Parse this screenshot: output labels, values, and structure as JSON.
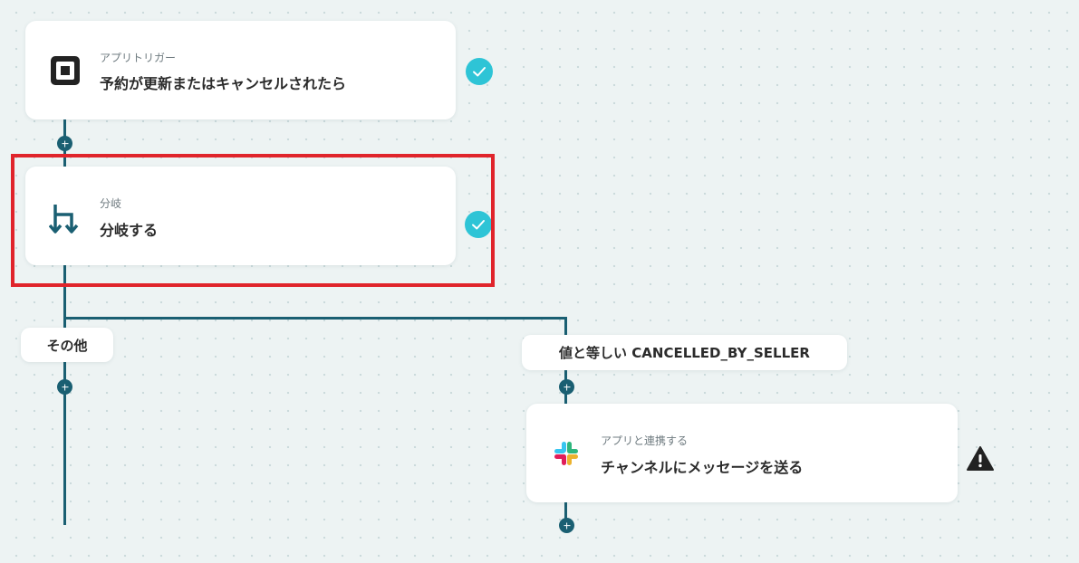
{
  "trigger_card": {
    "subtitle": "アプリトリガー",
    "title": "予約が更新またはキャンセルされたら",
    "icon": "square-app-icon",
    "status": "check-complete-icon"
  },
  "branch_card": {
    "subtitle": "分岐",
    "title": "分岐する",
    "icon": "branch-icon",
    "status": "check-complete-icon"
  },
  "branch_labels": {
    "other": "その他",
    "condition": "値と等しい CANCELLED_BY_SELLER"
  },
  "slack_card": {
    "subtitle": "アプリと連携する",
    "title": "チャンネルにメッセージを送る",
    "icon": "slack-icon",
    "status": "warning-icon"
  },
  "colors": {
    "line": "#1a5f72",
    "check": "#2ec4d6",
    "highlight": "#e0242b",
    "warning": "#222222"
  }
}
